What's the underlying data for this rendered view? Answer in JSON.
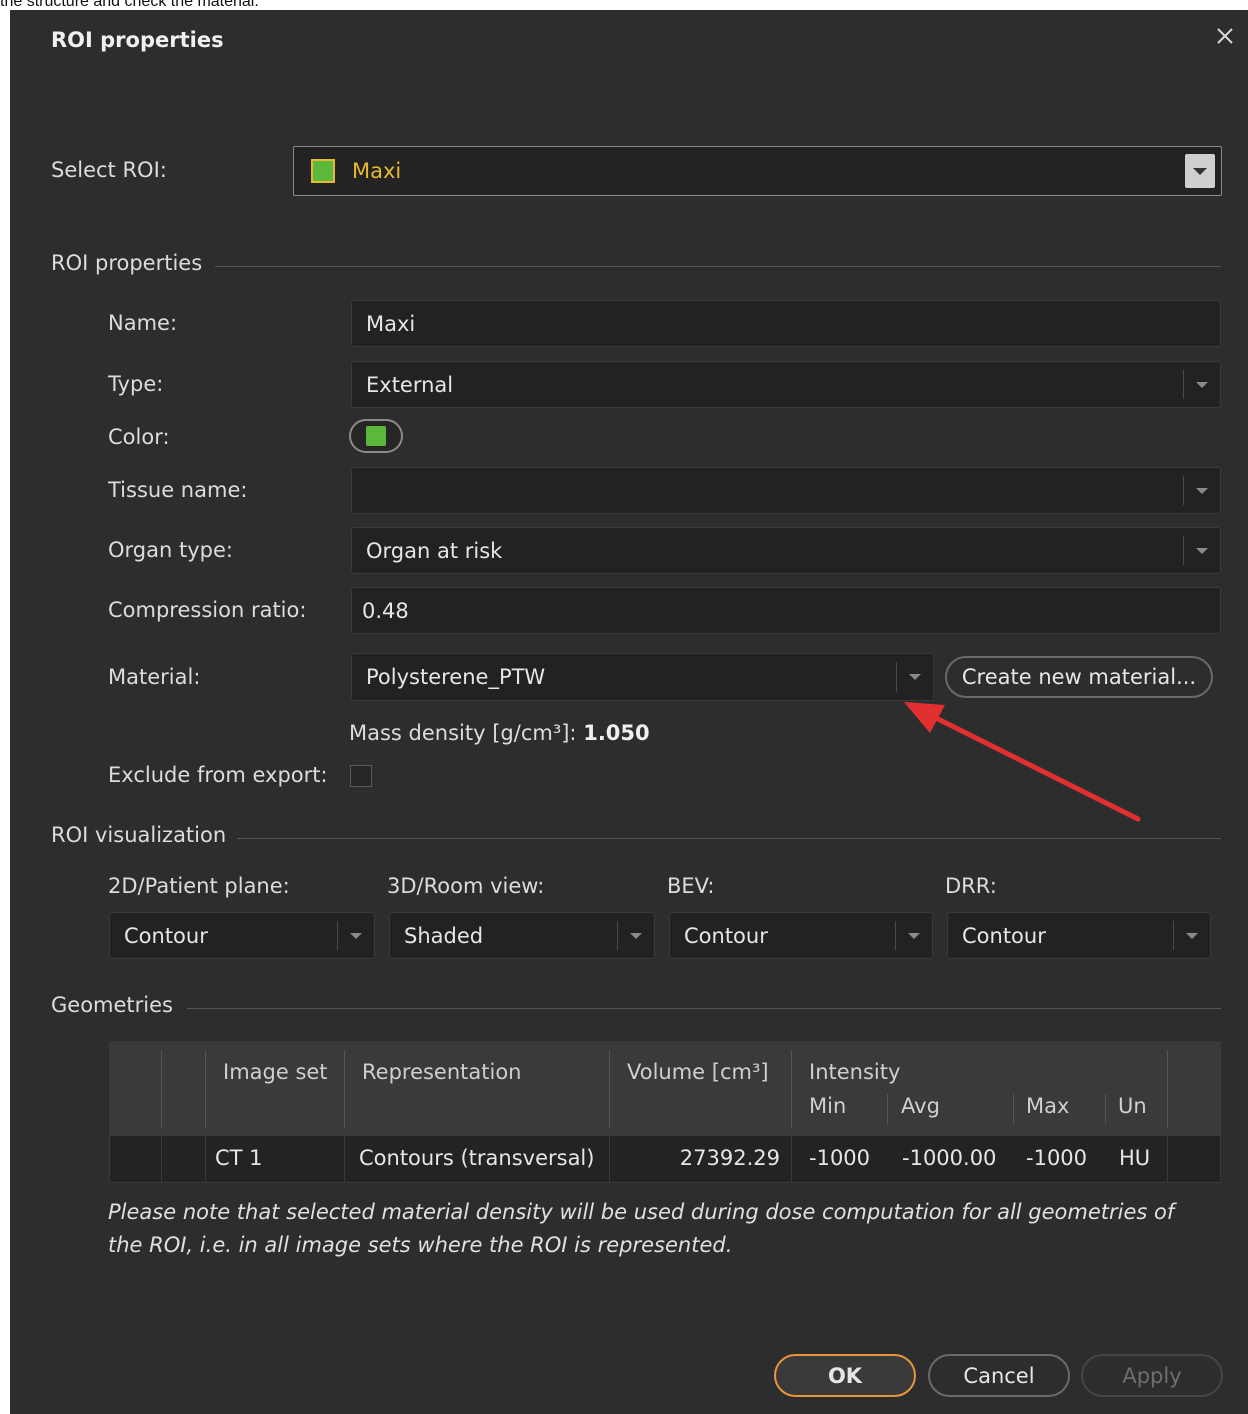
{
  "top_text": "the structure and check the material.",
  "dialog": {
    "title": "ROI properties",
    "close_glyph": "✕",
    "select_roi": {
      "label": "Select ROI:",
      "value": "Maxi",
      "swatch_color": "#5cb83a"
    },
    "roi_properties": {
      "section": "ROI properties",
      "name": {
        "label": "Name:",
        "value": "Maxi"
      },
      "type": {
        "label": "Type:",
        "value": "External"
      },
      "color": {
        "label": "Color:",
        "value": "#5cb83a"
      },
      "tissue_name": {
        "label": "Tissue name:",
        "value": ""
      },
      "organ_type": {
        "label": "Organ type:",
        "value": "Organ at risk"
      },
      "compression_ratio": {
        "label": "Compression ratio:",
        "value": "0.48"
      },
      "material": {
        "label": "Material:",
        "value": "Polysterene_PTW",
        "create_button": "Create new material..."
      },
      "mass_density": {
        "label": "Mass density [g/cm³]:",
        "value": "1.050"
      },
      "exclude_from_export": {
        "label": "Exclude from export:",
        "checked": false
      }
    },
    "roi_visualization": {
      "section": "ROI visualization",
      "patient_plane": {
        "label": "2D/Patient plane:",
        "value": "Contour"
      },
      "room_view": {
        "label": "3D/Room view:",
        "value": "Shaded"
      },
      "bev": {
        "label": "BEV:",
        "value": "Contour"
      },
      "drr": {
        "label": "DRR:",
        "value": "Contour"
      }
    },
    "geometries": {
      "section": "Geometries",
      "headers": {
        "image_set": "Image set",
        "representation": "Representation",
        "volume": "Volume [cm³]",
        "intensity": "Intensity",
        "min": "Min",
        "avg": "Avg",
        "max": "Max",
        "unit": "Un"
      },
      "row": {
        "image_set": "CT 1",
        "representation": "Contours (transversal)",
        "volume": "27392.29",
        "min": "-1000",
        "avg": "-1000.00",
        "max": "-1000",
        "unit": "HU"
      }
    },
    "note": "Please note that selected material density will be used during dose computation for all geometries of the ROI, i.e. in all image sets where the ROI is represented.",
    "buttons": {
      "ok": "OK",
      "cancel": "Cancel",
      "apply": "Apply"
    },
    "colors": {
      "accent": "#e8963a",
      "select_text": "#e8b830",
      "annotation_arrow": "#e23030"
    }
  }
}
